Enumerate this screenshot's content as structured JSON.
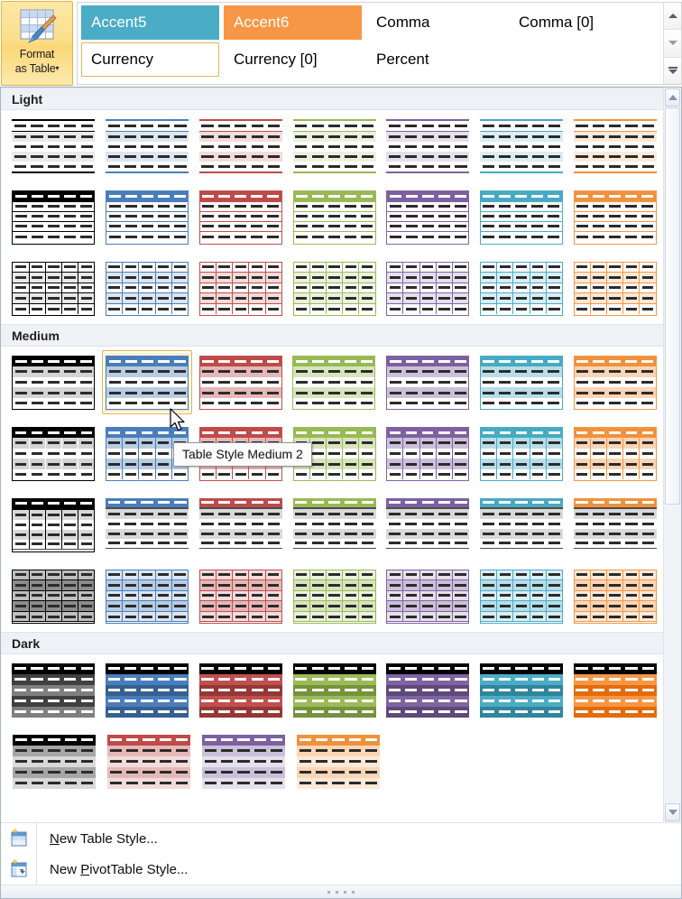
{
  "ribbon": {
    "format_as_table": {
      "label_line1": "Format",
      "label_line2": "as Table",
      "dropdown_arrow": "▾",
      "icon": "table-paintbrush-icon"
    },
    "cell_styles": [
      {
        "label": "Accent5",
        "fill": "#4bacc6",
        "text": "#ffffff",
        "selected": false
      },
      {
        "label": "Accent6",
        "fill": "#f79646",
        "text": "#ffffff",
        "selected": false
      },
      {
        "label": "Comma",
        "fill": "",
        "text": "#000000",
        "selected": false
      },
      {
        "label": "Comma [0]",
        "fill": "",
        "text": "#000000",
        "selected": false
      },
      {
        "label": "Currency",
        "fill": "",
        "text": "#000000",
        "selected": true
      },
      {
        "label": "Currency [0]",
        "fill": "",
        "text": "#000000",
        "selected": false
      },
      {
        "label": "Percent",
        "fill": "",
        "text": "#000000",
        "selected": false
      }
    ],
    "scroll_buttons": [
      "scroll-up-icon",
      "scroll-down-icon",
      "more-styles-icon"
    ]
  },
  "panel": {
    "groups": [
      {
        "title": "Light",
        "rows": 3
      },
      {
        "title": "Medium",
        "rows": 4
      },
      {
        "title": "Dark",
        "rows": 2
      }
    ],
    "theme_colors": {
      "none": "#000000",
      "blue": "#4a7ebb",
      "red": "#be4b48",
      "green": "#94b council",
      "purple": "#7d60a0",
      "aqua": "#46aac3",
      "orange": "#f0913c"
    },
    "selected_style": "Table Style Medium 2",
    "tooltip": "Table Style Medium 2",
    "commands": [
      {
        "icon": "new-table-style-icon",
        "pre": "",
        "accel": "N",
        "post": "ew Table Style..."
      },
      {
        "icon": "new-pivottable-style-icon",
        "pre": "New ",
        "accel": "P",
        "post": "ivotTable Style..."
      }
    ],
    "scrollbar": {
      "up": "scroll-up-icon",
      "down": "scroll-down-icon"
    },
    "grip_dots": 4
  },
  "styles_matrix": {
    "light": [
      {
        "variant": "light-1",
        "colors": [
          "none",
          "blue",
          "red",
          "green",
          "purple",
          "aqua",
          "orange"
        ]
      },
      {
        "variant": "light-2",
        "colors": [
          "none",
          "blue",
          "red",
          "green",
          "purple",
          "aqua",
          "orange"
        ]
      },
      {
        "variant": "light-3",
        "colors": [
          "none",
          "blue",
          "red",
          "green",
          "purple",
          "aqua",
          "orange"
        ]
      }
    ],
    "medium": [
      {
        "variant": "medium-1",
        "colors": [
          "none",
          "blue",
          "red",
          "green",
          "purple",
          "aqua",
          "orange"
        ]
      },
      {
        "variant": "medium-2",
        "colors": [
          "none",
          "blue",
          "red",
          "green",
          "purple",
          "aqua",
          "orange"
        ]
      },
      {
        "variant": "medium-3",
        "colors": [
          "none",
          "blue",
          "red",
          "green",
          "purple",
          "aqua",
          "orange"
        ]
      },
      {
        "variant": "medium-4",
        "colors": [
          "none",
          "blue",
          "red",
          "green",
          "purple",
          "aqua",
          "orange"
        ]
      }
    ],
    "dark": [
      {
        "variant": "dark-1",
        "colors": [
          "none",
          "blue",
          "red",
          "green",
          "purple",
          "aqua",
          "orange"
        ]
      },
      {
        "variant": "dark-2",
        "colors": [
          "none",
          "red",
          "purple",
          "orange"
        ]
      }
    ]
  }
}
